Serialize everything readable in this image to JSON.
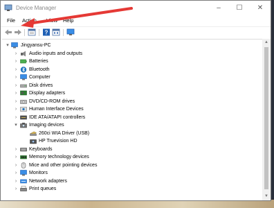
{
  "window": {
    "title": "Device Manager",
    "controls": [
      "–",
      "☐",
      "✕"
    ]
  },
  "menu": [
    "File",
    "Action",
    "View",
    "Help"
  ],
  "toolbar": [
    "back-icon",
    "forward-icon",
    "properties-icon",
    "help-icon",
    "details-icon",
    "monitor-icon"
  ],
  "tree": {
    "root": "Jingyansu-PC",
    "items": [
      {
        "label": "Audio inputs and outputs",
        "icon": "speaker-icon",
        "expanded": false
      },
      {
        "label": "Batteries",
        "icon": "battery-icon",
        "expanded": false
      },
      {
        "label": "Bluetooth",
        "icon": "bluetooth-icon",
        "expanded": false
      },
      {
        "label": "Computer",
        "icon": "computer-icon",
        "expanded": false
      },
      {
        "label": "Disk drives",
        "icon": "disk-drive-icon",
        "expanded": false
      },
      {
        "label": "Display adapters",
        "icon": "display-adapter-icon",
        "expanded": false
      },
      {
        "label": "DVD/CD-ROM drives",
        "icon": "dvd-drive-icon",
        "expanded": false
      },
      {
        "label": "Human Interface Devices",
        "icon": "hid-icon",
        "expanded": false
      },
      {
        "label": "IDE ATA/ATAPI controllers",
        "icon": "ide-controller-icon",
        "expanded": false
      },
      {
        "label": "Imaging devices",
        "icon": "camera-icon",
        "expanded": true,
        "children": [
          {
            "label": "260ci WIA Driver (USB)",
            "icon": "scanner-icon"
          },
          {
            "label": "HP Truevision HD",
            "icon": "webcam-icon"
          }
        ]
      },
      {
        "label": "Keyboards",
        "icon": "keyboard-icon",
        "expanded": false
      },
      {
        "label": "Memory technology devices",
        "icon": "memory-icon",
        "expanded": false
      },
      {
        "label": "Mice and other pointing devices",
        "icon": "mouse-icon",
        "expanded": false
      },
      {
        "label": "Monitors",
        "icon": "monitor-icon",
        "expanded": false
      },
      {
        "label": "Network adapters",
        "icon": "network-adapter-icon",
        "expanded": false
      },
      {
        "label": "Print queues",
        "icon": "printer-icon",
        "expanded": false
      }
    ]
  },
  "colors": {
    "annotation_arrow": "#e53935",
    "icon_blue": "#1e73be"
  }
}
